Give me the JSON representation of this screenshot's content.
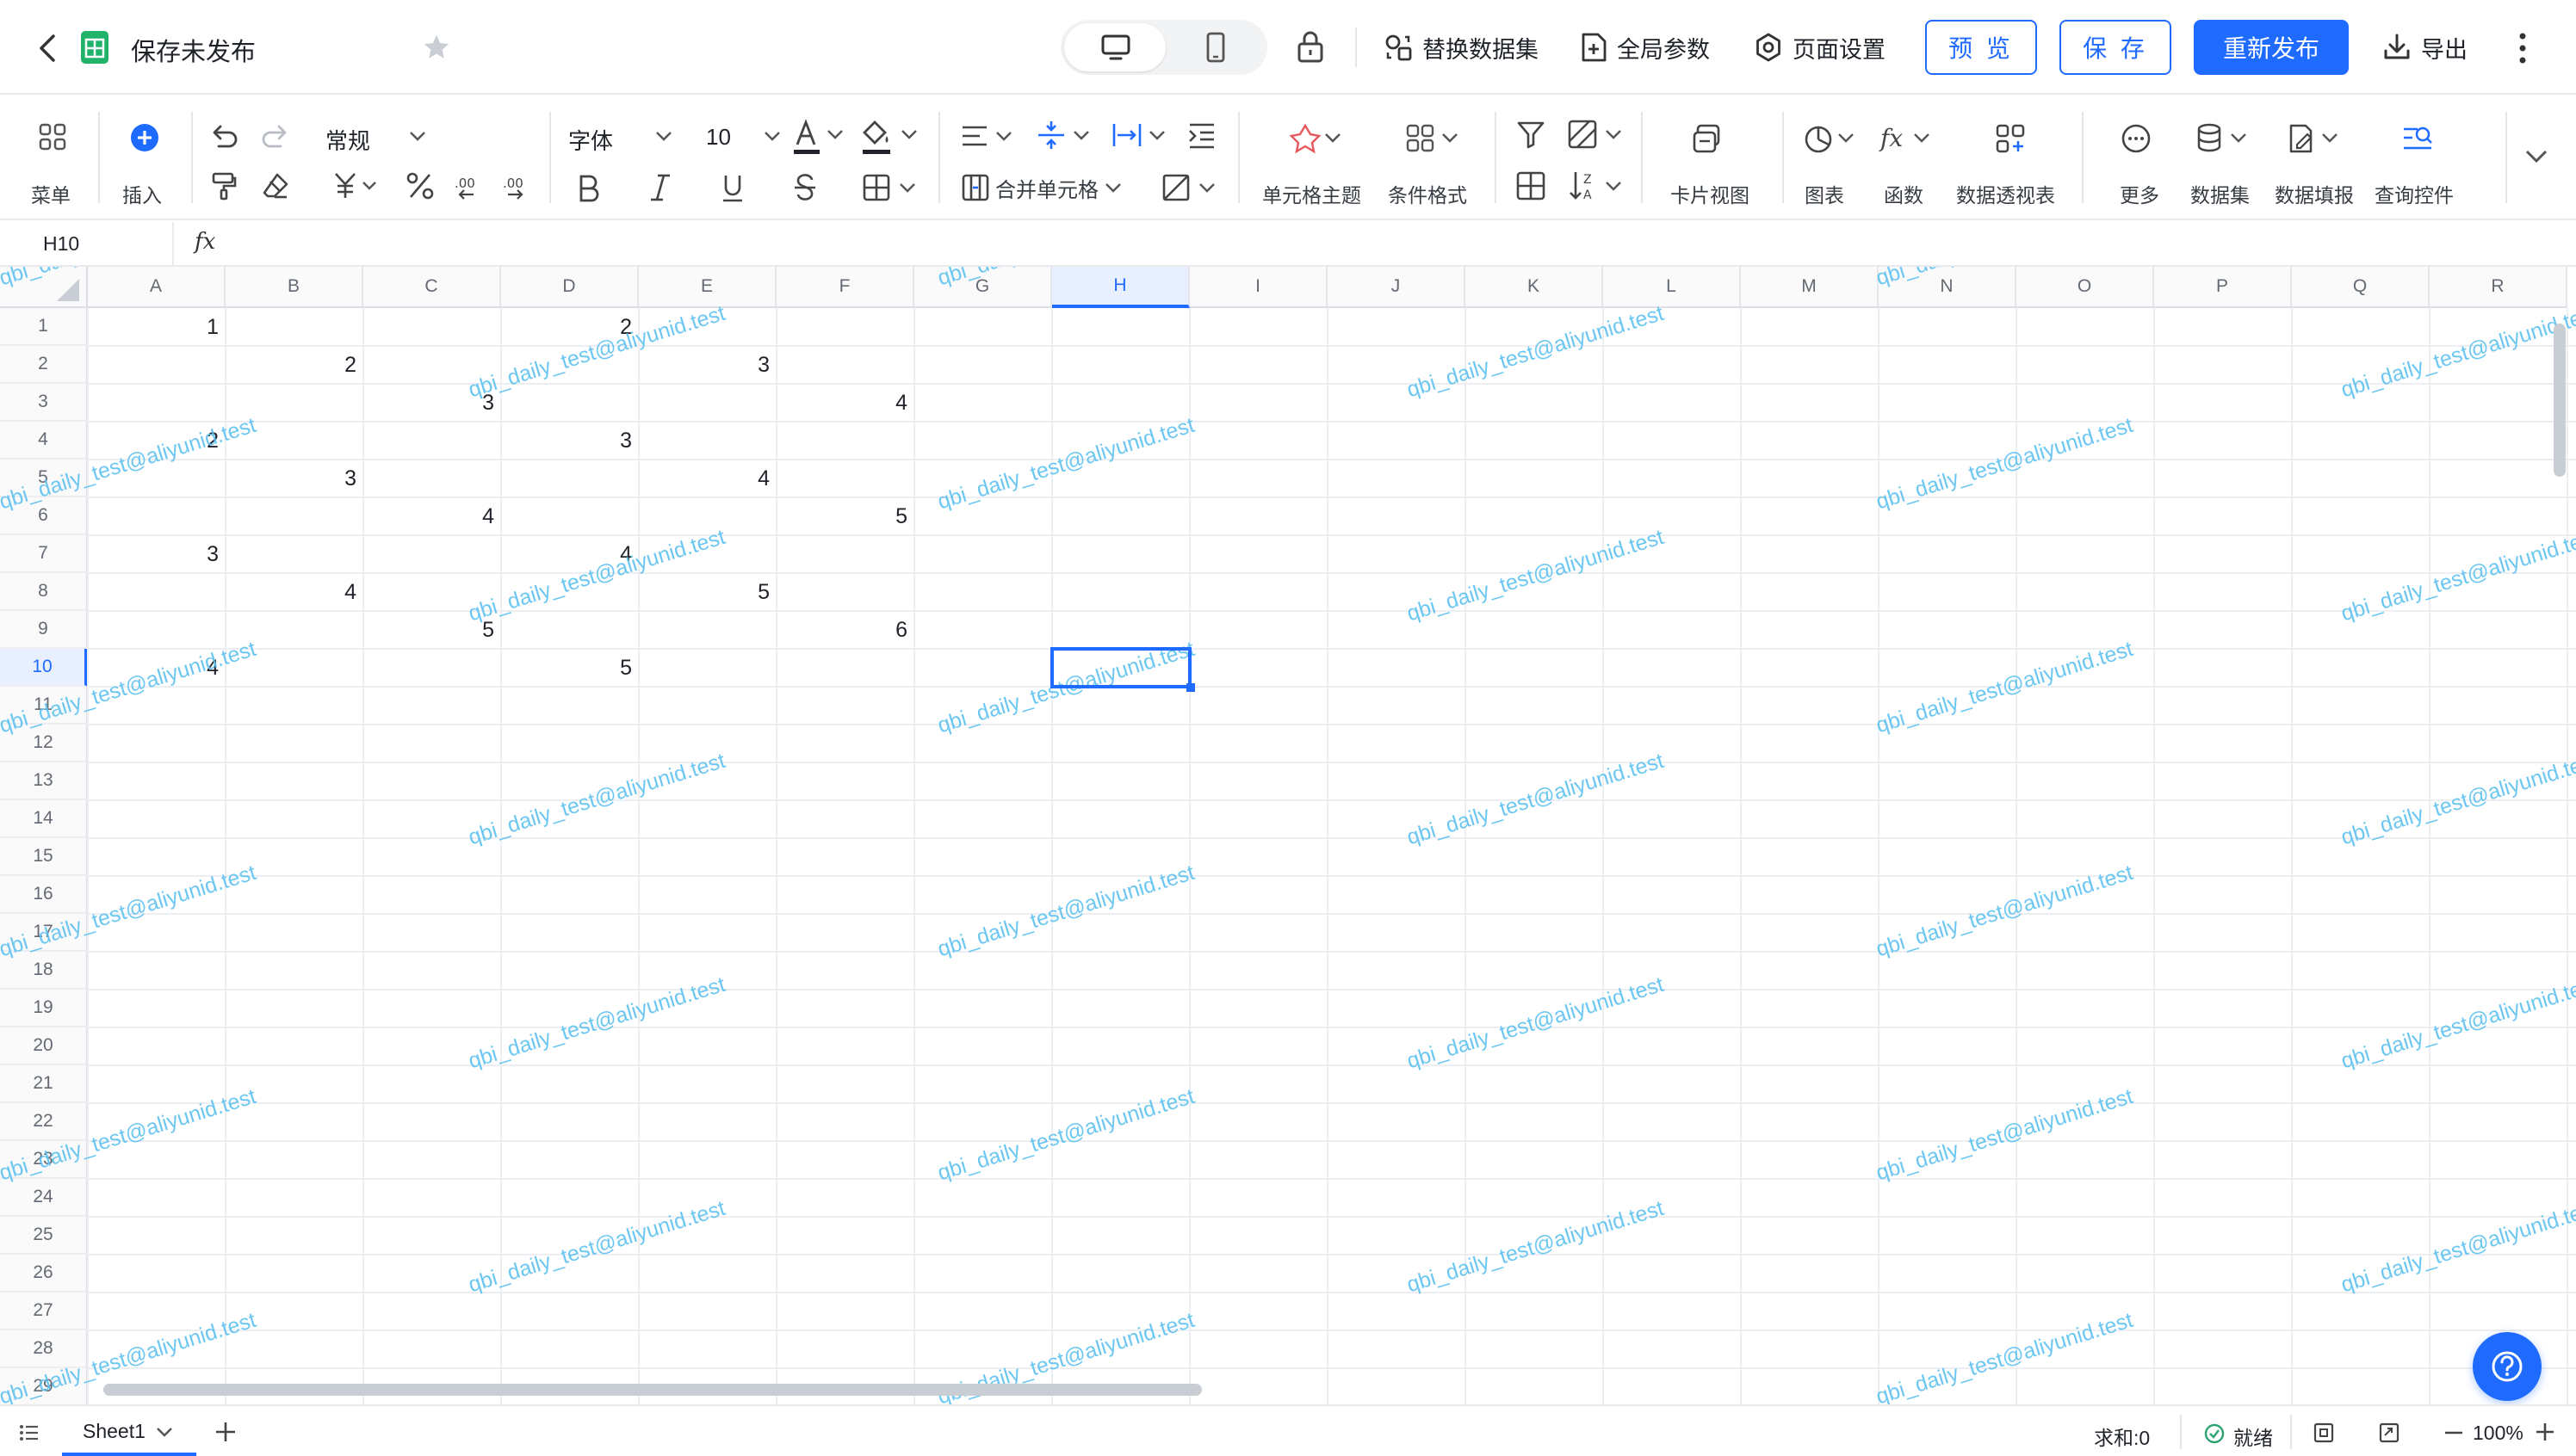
{
  "header": {
    "doc_title": "保存未发布",
    "replace_dataset": "替换数据集",
    "global_params": "全局参数",
    "page_settings": "页面设置",
    "preview": "预 览",
    "save": "保 存",
    "republish": "重新发布",
    "export": "导出"
  },
  "toolbar": {
    "menu": "菜单",
    "insert": "插入",
    "format_value": "常规",
    "font_value": "字体",
    "font_size": "10",
    "merge_cells": "合并单元格",
    "cell_theme": "单元格主题",
    "conditional_format": "条件格式",
    "card_view": "卡片视图",
    "chart": "图表",
    "function": "函数",
    "pivot": "数据透视表",
    "more": "更多",
    "dataset": "数据集",
    "data_fill": "数据填报",
    "query_control": "查询控件"
  },
  "formula": {
    "cell_ref": "H10",
    "fx": "fx",
    "content": ""
  },
  "grid": {
    "columns": [
      "A",
      "B",
      "C",
      "D",
      "E",
      "F",
      "G",
      "H",
      "I",
      "J",
      "K",
      "L",
      "M",
      "N",
      "O",
      "P",
      "Q",
      "R"
    ],
    "rows": [
      "1",
      "2",
      "3",
      "4",
      "5",
      "6",
      "7",
      "8",
      "9",
      "10",
      "11",
      "12",
      "13",
      "14",
      "15",
      "16",
      "17",
      "18",
      "19",
      "20",
      "21",
      "22",
      "23",
      "24",
      "25",
      "26",
      "27",
      "28",
      "29"
    ],
    "cells": [
      {
        "row": 1,
        "col": "A",
        "value": "1"
      },
      {
        "row": 1,
        "col": "D",
        "value": "2"
      },
      {
        "row": 2,
        "col": "B",
        "value": "2"
      },
      {
        "row": 2,
        "col": "E",
        "value": "3"
      },
      {
        "row": 3,
        "col": "C",
        "value": "3"
      },
      {
        "row": 3,
        "col": "F",
        "value": "4"
      },
      {
        "row": 4,
        "col": "A",
        "value": "2"
      },
      {
        "row": 4,
        "col": "D",
        "value": "3"
      },
      {
        "row": 5,
        "col": "B",
        "value": "3"
      },
      {
        "row": 5,
        "col": "E",
        "value": "4"
      },
      {
        "row": 6,
        "col": "C",
        "value": "4"
      },
      {
        "row": 6,
        "col": "F",
        "value": "5"
      },
      {
        "row": 7,
        "col": "A",
        "value": "3"
      },
      {
        "row": 7,
        "col": "D",
        "value": "4"
      },
      {
        "row": 8,
        "col": "B",
        "value": "4"
      },
      {
        "row": 8,
        "col": "E",
        "value": "5"
      },
      {
        "row": 9,
        "col": "C",
        "value": "5"
      },
      {
        "row": 9,
        "col": "F",
        "value": "6"
      },
      {
        "row": 10,
        "col": "A",
        "value": "4"
      },
      {
        "row": 10,
        "col": "D",
        "value": "5"
      }
    ],
    "selected_cell": "H10",
    "watermark": "qbi_daily_test@aliyunid.test"
  },
  "footer": {
    "sheet_name": "Sheet1",
    "sum": "求和:0",
    "status": "就绪",
    "zoom": "100%"
  },
  "colors": {
    "accent": "#1f6bff",
    "watermark": "#5cc1f0",
    "ready": "#2ba471"
  }
}
